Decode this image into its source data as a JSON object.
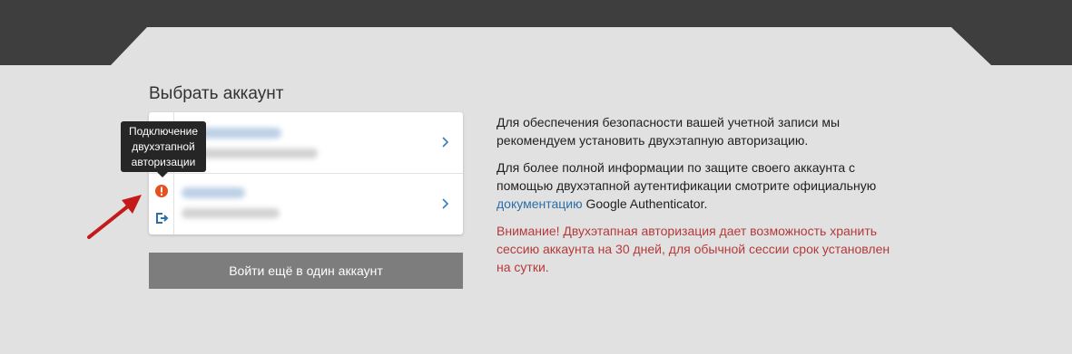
{
  "header": {
    "color": "#3e3e3e"
  },
  "panel": {
    "title": "Выбрать аккаунт"
  },
  "accounts": [
    {
      "status_icon": "none"
    },
    {
      "status_icon": "warning-icon",
      "action_icon": "logout-icon"
    }
  ],
  "tooltip": {
    "lines": [
      "Подключение",
      "двухэтапной",
      "авторизации"
    ]
  },
  "login_button": {
    "label": "Войти ещё в один аккаунт"
  },
  "info": {
    "paragraph1": "Для обеспечения безопасности вашей учетной записи мы рекомендуем установить двухэтапную авторизацию.",
    "paragraph2_before": "Для более полной информации по защите своего аккаунта с помощью двухэтапной аутентификации смотрите официальную ",
    "paragraph2_link": "документацию",
    "paragraph2_after": " Google Authenticator.",
    "warning": "Внимание! Двухэтапная авторизация дает возможность хранить сессию аккаунта на 30 дней, для обычной сессии срок установлен на сутки."
  },
  "colors": {
    "accent_link": "#2c6ea8",
    "warning": "#b43a3a",
    "warn_icon": "#e8501f",
    "arrow": "#c41a1a"
  }
}
